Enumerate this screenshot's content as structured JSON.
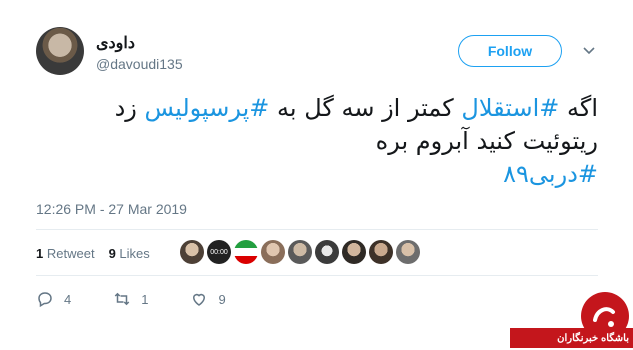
{
  "author": {
    "display_name": "داودی",
    "handle": "@davoudi135"
  },
  "follow_button": {
    "label": "Follow"
  },
  "tweet": {
    "line1_a": "اگه ",
    "hashtag1": "#استقلال",
    "line1_b": " کمتر از سه گل به ",
    "hashtag2": "#پرسپولیس",
    "line1_c": " زد",
    "line2": "ریتوئیت کنید آبروم بره",
    "hashtag3": "#دربی۸۹"
  },
  "timestamp": "12:26 PM - 27 Mar 2019",
  "stats": {
    "retweets_count": "1",
    "retweets_label": "Retweet",
    "likes_count": "9",
    "likes_label": "Likes"
  },
  "actions": {
    "reply_count": "4",
    "retweet_count": "1",
    "like_count": "9"
  },
  "colors": {
    "accent": "#1da1f2",
    "hashtag": "#1b95e0",
    "muted": "#657786"
  },
  "watermark": {
    "text": "باشگاه خبرنگاران"
  }
}
